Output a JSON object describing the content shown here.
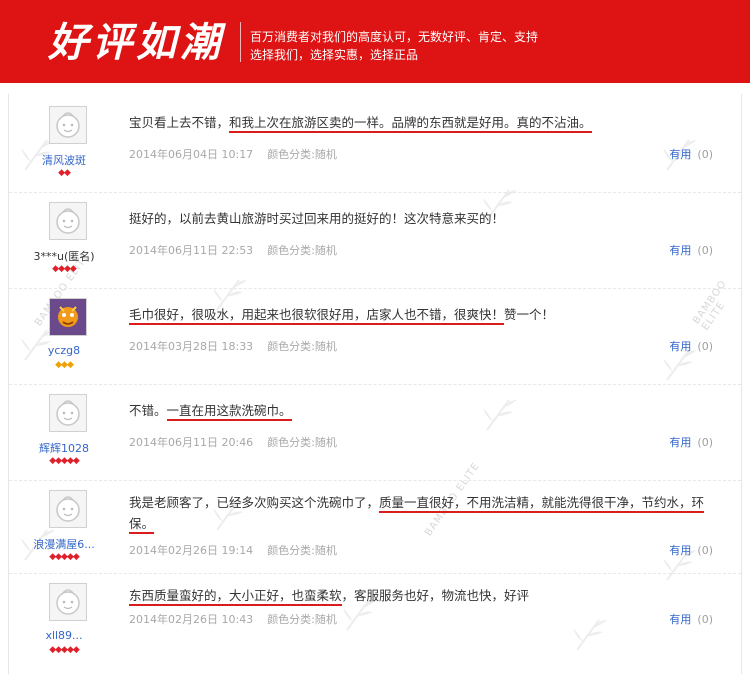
{
  "header": {
    "title": "好评如潮",
    "subtitle_line1": "百万消费者对我们的高度认可，无数好评、肯定、支持",
    "subtitle_line2": "选择我们，选择实惠，选择正品"
  },
  "watermark": "BAMBOO ELITE",
  "colors": {
    "header_bg": "#de1313",
    "underline": "#d91c1c",
    "link": "#3366cc"
  },
  "reviews": [
    {
      "username": "清风波斑",
      "rank": [
        "gem",
        "gem"
      ],
      "text_parts": [
        {
          "t": "宝贝看上去不错，",
          "u": false
        },
        {
          "t": "和我上次在旅游区卖的一样。品牌的东西就是好用。真的不沾油。",
          "u": true
        }
      ],
      "date": "2014年06月04日 10:17",
      "category": "颜色分类:随机",
      "useful_label": "有用",
      "useful_count": "(0)"
    },
    {
      "username": "3***u(匿名)",
      "rank": [
        "gem",
        "gem",
        "gem",
        "gem"
      ],
      "text_parts": [
        {
          "t": "挺好的，以前去黄山旅游时买过回来用的挺好的！这次特意来买的！",
          "u": false
        }
      ],
      "date": "2014年06月11日 22:53",
      "category": "颜色分类:随机",
      "useful_label": "有用",
      "useful_count": "(0)"
    },
    {
      "username": "yczg8",
      "rank": [
        "gold",
        "gold",
        "gold"
      ],
      "text_parts": [
        {
          "t": "毛巾很好，很吸水，用起来也很软很好用，店家人也不错，很爽快！",
          "u": true
        },
        {
          "t": "赞一个！",
          "u": false
        }
      ],
      "date": "2014年03月28日 18:33",
      "category": "颜色分类:随机",
      "useful_label": "有用",
      "useful_count": "(0)"
    },
    {
      "username": "辉辉1028",
      "rank": [
        "gem",
        "gem",
        "gem",
        "gem",
        "gem"
      ],
      "text_parts": [
        {
          "t": "不错。",
          "u": false
        },
        {
          "t": "一直在用这款洗碗巾。",
          "u": true
        }
      ],
      "date": "2014年06月11日 20:46",
      "category": "颜色分类:随机",
      "useful_label": "有用",
      "useful_count": "(0)"
    },
    {
      "username": "浪漫满屋6...",
      "rank": [
        "gem",
        "gem",
        "gem",
        "gem",
        "gem"
      ],
      "text_parts": [
        {
          "t": "我是老顾客了，已经多次购买这个洗碗巾了，",
          "u": false
        },
        {
          "t": "质量一直很好，不用洗洁精，就能洗得很干净，节约水，环保。",
          "u": true
        }
      ],
      "date": "2014年02月26日 19:14",
      "category": "颜色分类:随机",
      "useful_label": "有用",
      "useful_count": "(0)"
    },
    {
      "username": "xll89...",
      "rank": [
        "gem",
        "gem",
        "gem",
        "gem",
        "gem"
      ],
      "text_parts": [
        {
          "t": "东西质量蛮好的，大小正好，也蛮柔软",
          "u": true
        },
        {
          "t": "，客服服务也好，物流也快，好评",
          "u": false
        }
      ],
      "date": "2014年02月26日 10:43",
      "category": "颜色分类:随机",
      "useful_label": "有用",
      "useful_count": "(0)"
    }
  ]
}
